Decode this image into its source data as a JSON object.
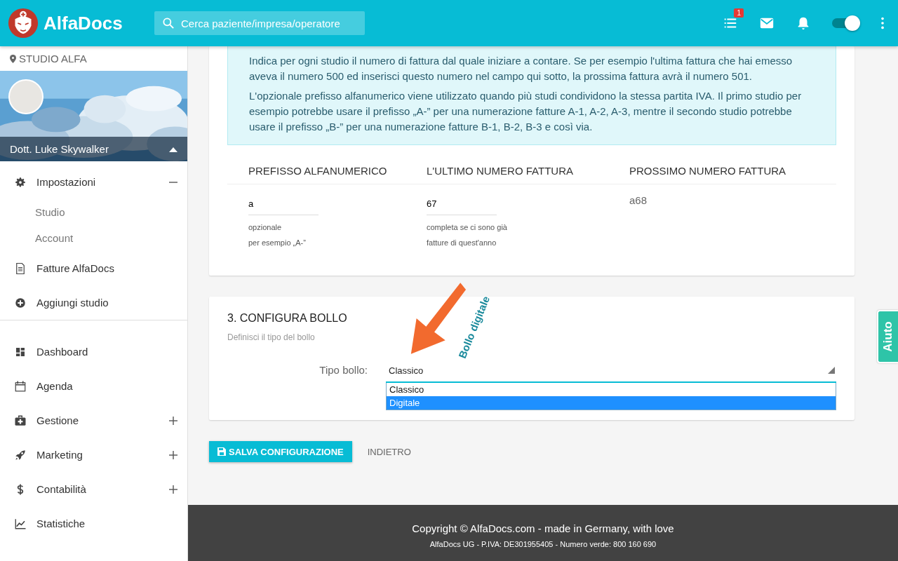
{
  "header": {
    "logo_text": "AlfaDocs",
    "search": {
      "placeholder": "Cerca paziente/impresa/operatore"
    },
    "tasks_badge": "1",
    "theme_toggle": {
      "on": true
    }
  },
  "sidebar": {
    "location": "STUDIO ALFA",
    "user_name": "Dott. Luke Skywalker",
    "user_menu": {
      "expanded": true
    },
    "menu_top": [
      {
        "kind": "group",
        "label": "Impostazioni",
        "expanded": true,
        "children": [
          {
            "label": "Studio"
          },
          {
            "label": "Account"
          }
        ]
      },
      {
        "kind": "link",
        "label": "Fatture AlfaDocs"
      },
      {
        "kind": "link",
        "label": "Aggiungi studio"
      }
    ],
    "menu_main": [
      {
        "kind": "link",
        "label": "Dashboard"
      },
      {
        "kind": "link",
        "label": "Agenda"
      },
      {
        "kind": "group",
        "label": "Gestione",
        "expanded": false
      },
      {
        "kind": "group",
        "label": "Marketing",
        "expanded": false
      },
      {
        "kind": "group",
        "label": "Contabilità",
        "expanded": false
      },
      {
        "kind": "link",
        "label": "Statistiche"
      }
    ]
  },
  "numbering": {
    "info": [
      "Indica per ogni studio il numero di fattura dal quale iniziare a contare. Se per esempio l'ultima fattura che hai emesso aveva il numero 500 ed inserisci questo numero nel campo qui sotto, la prossima fattura avrà il numero 501.",
      "L'opzionale prefisso alfanumerico viene utilizzato quando più studi condividono la stessa partita IVA. Il primo studio per esempio potrebbe usare il prefisso „A-” per una numerazione fatture A-1, A-2, A-3, mentre il secondo studio potrebbe usare il prefisso „B-” per una numerazione fatture B-1, B-2, B-3 e così via."
    ],
    "columns": [
      "PREFISSO ALFANUMERICO",
      "L'ULTIMO NUMERO FATTURA",
      "PROSSIMO NUMERO FATTURA"
    ],
    "prefix": {
      "value": "a",
      "hints": [
        "opzionale",
        "per esempio „A-”"
      ]
    },
    "last_number": {
      "value": "67",
      "hints": [
        "completa se ci sono già",
        "fatture di quest'anno"
      ]
    },
    "next_number": "a68"
  },
  "bollo": {
    "title": "3. CONFIGURA BOLLO",
    "subtitle": "Definisci il tipo del bollo",
    "label": "Tipo bollo:",
    "value": "Classico",
    "options": [
      {
        "label": "Classico",
        "highlighted": false
      },
      {
        "label": "Digitale",
        "highlighted": true
      }
    ]
  },
  "annotation": {
    "text": "Bollo digitale"
  },
  "actions": {
    "save": "SALVA CONFIGURAZIONE",
    "back": "INDIETRO"
  },
  "help_tab": "Aiuto",
  "footer": {
    "copyright": "Copyright © AlfaDocs.com - made in Germany, with love",
    "company": "AlfaDocs UG - P.IVA: DE301955405 - Numero verde: 800 160 690"
  }
}
